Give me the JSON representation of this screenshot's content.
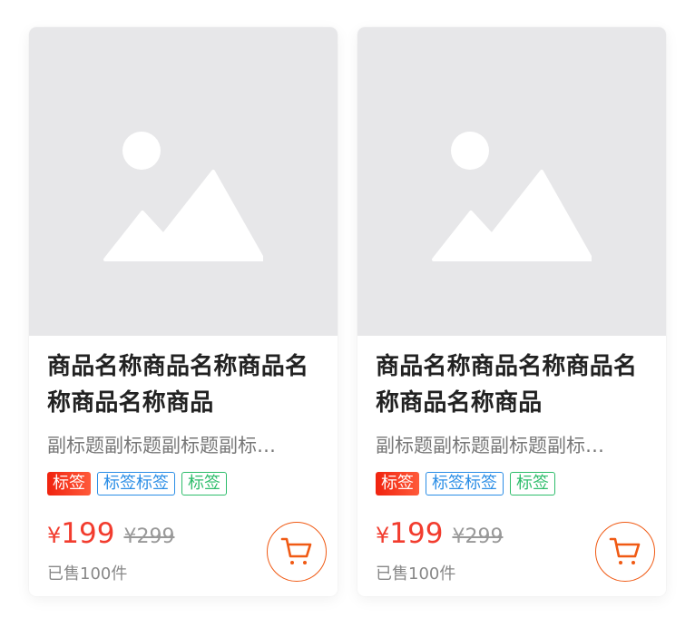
{
  "colors": {
    "price": "#f23c2e",
    "cart_accent": "#f05a14",
    "tag_red": "#f0230f",
    "tag_blue": "#2b8ee6",
    "tag_green": "#2ebd6b",
    "thumb_bg": "#e7e7e9"
  },
  "products": [
    {
      "image_icon": "image-placeholder-icon",
      "title": "商品名称商品名称商品名称商品名称商品",
      "subtitle": "副标题副标题副标题副标…",
      "tags": [
        "标签",
        "标签标签",
        "标签"
      ],
      "currency": "¥",
      "price": "199",
      "original_price": "¥299",
      "sold": "已售100件",
      "cart_icon": "shopping-cart-icon"
    },
    {
      "image_icon": "image-placeholder-icon",
      "title": "商品名称商品名称商品名称商品名称商品",
      "subtitle": "副标题副标题副标题副标…",
      "tags": [
        "标签",
        "标签标签",
        "标签"
      ],
      "currency": "¥",
      "price": "199",
      "original_price": "¥299",
      "sold": "已售100件",
      "cart_icon": "shopping-cart-icon"
    }
  ]
}
